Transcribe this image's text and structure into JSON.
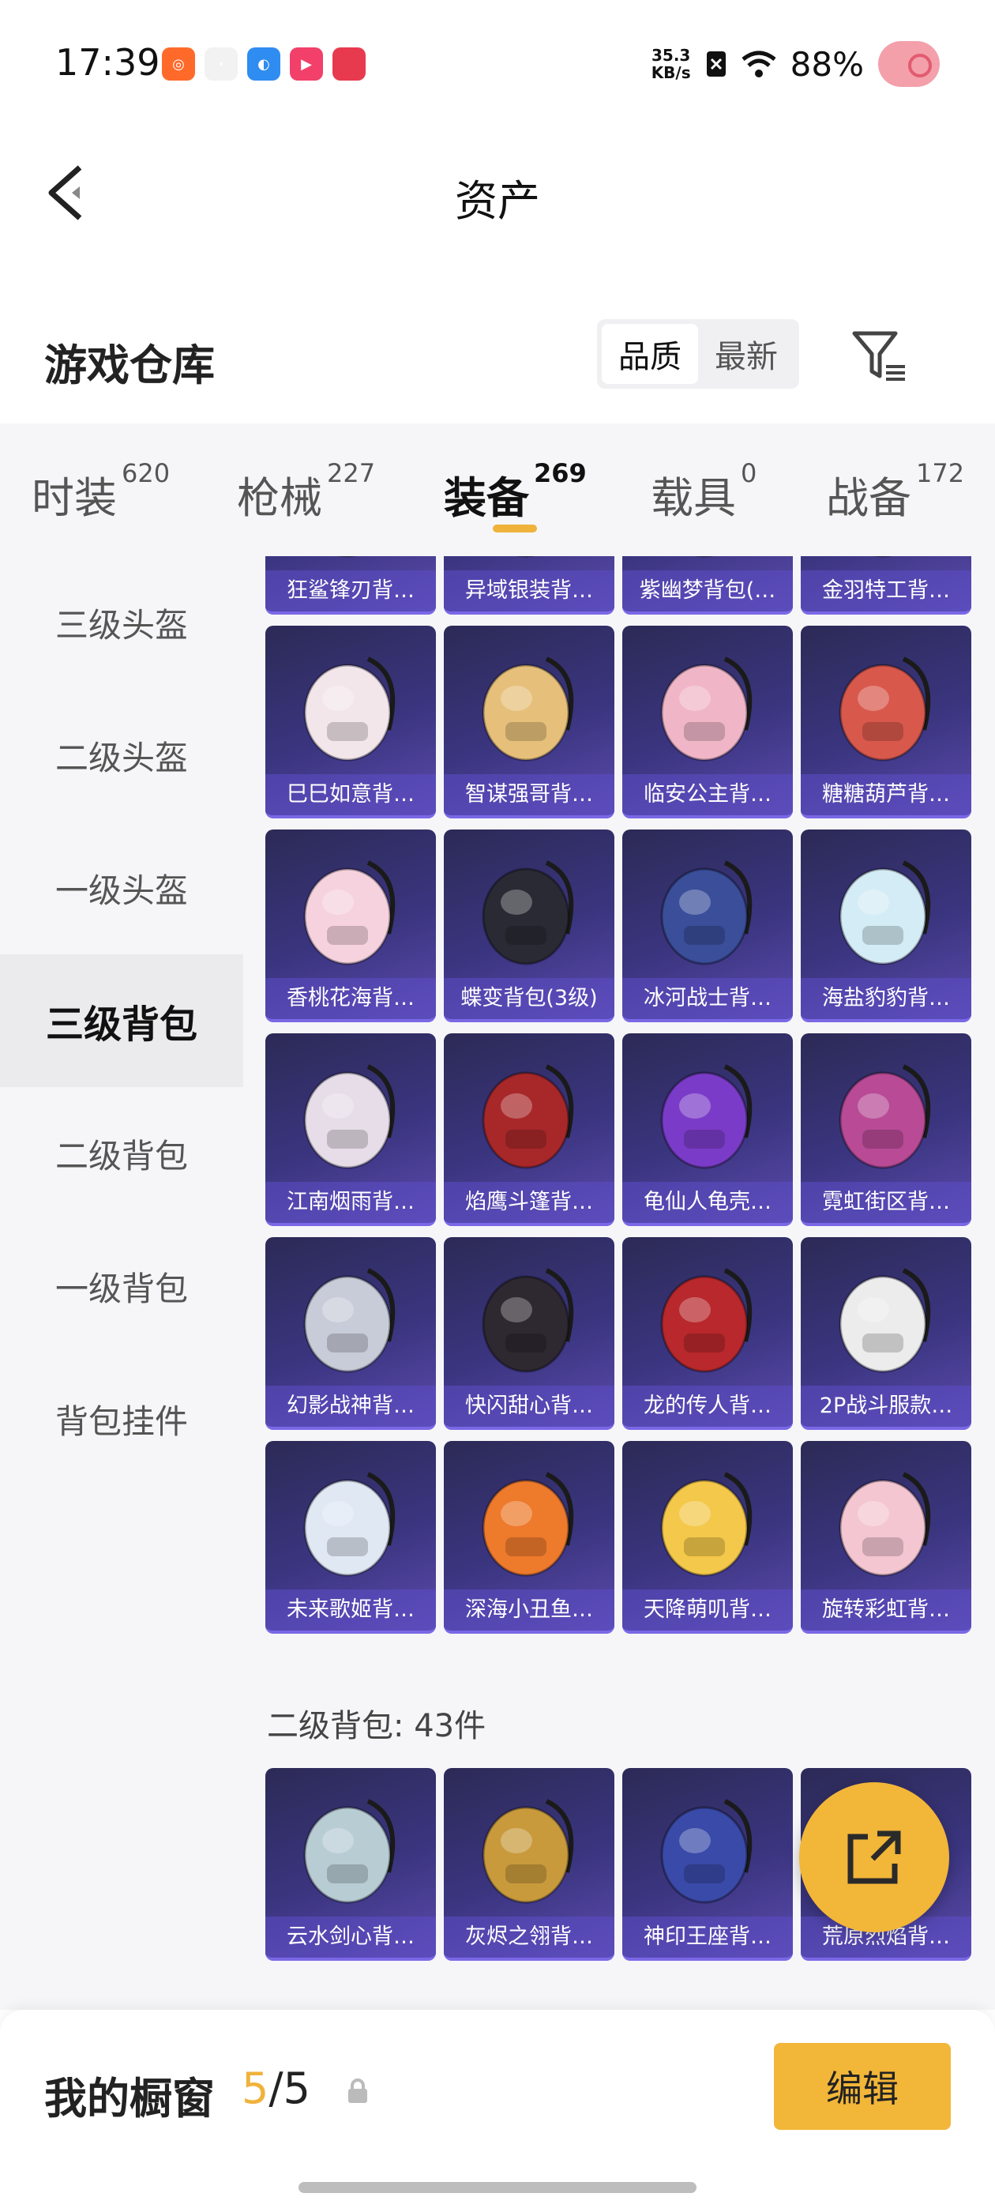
{
  "status": {
    "time": "17:39",
    "net_speed_value": "35.3",
    "net_speed_unit": "KB/s",
    "battery": "88%",
    "app_icons": [
      {
        "name": "kuaishou-app-icon",
        "color": "#ff6a2b",
        "glyph": "◎"
      },
      {
        "name": "small-app-icon",
        "color": "#f2f2f2",
        "glyph": "·"
      },
      {
        "name": "blue-app-icon",
        "color": "#2f8cf0",
        "glyph": "◐"
      },
      {
        "name": "video-app-icon",
        "color": "#f2406a",
        "glyph": "▶"
      },
      {
        "name": "red-app-icon",
        "color": "#e83a4f",
        "glyph": ""
      }
    ]
  },
  "header": {
    "title": "资产"
  },
  "warehouse": {
    "title": "游戏仓库",
    "sort_options": [
      "品质",
      "最新"
    ],
    "active_sort": "品质"
  },
  "tabs": [
    {
      "label": "时装",
      "count": "620"
    },
    {
      "label": "枪械",
      "count": "227"
    },
    {
      "label": "装备",
      "count": "269"
    },
    {
      "label": "载具",
      "count": "0"
    },
    {
      "label": "战备",
      "count": "172"
    }
  ],
  "sidebar": {
    "items": [
      "三级头盔",
      "二级头盔",
      "一级头盔",
      "三级背包",
      "二级背包",
      "一级背包",
      "背包挂件"
    ],
    "active": "三级背包"
  },
  "grid_level3": {
    "items": [
      {
        "label": "狂鲨锋刃背…",
        "color": "#8a6a3a"
      },
      {
        "label": "异域银装背…",
        "color": "#5c7a8a"
      },
      {
        "label": "紫幽梦背包(…",
        "color": "#b8a8e8"
      },
      {
        "label": "金羽特工背…",
        "color": "#4a4030"
      },
      {
        "label": "巳巳如意背…",
        "color": "#f3e6ea"
      },
      {
        "label": "智谋强哥背…",
        "color": "#e6c07a"
      },
      {
        "label": "临安公主背…",
        "color": "#f0b6c8"
      },
      {
        "label": "糖糖葫芦背…",
        "color": "#d8584c"
      },
      {
        "label": "香桃花海背…",
        "color": "#f6d2de"
      },
      {
        "label": "蝶变背包(3级)",
        "color": "#2a2a34"
      },
      {
        "label": "冰河战士背…",
        "color": "#3a4e9a"
      },
      {
        "label": "海盐豹豹背…",
        "color": "#d4ecf6"
      },
      {
        "label": "江南烟雨背…",
        "color": "#e6dde8"
      },
      {
        "label": "焰鹰斗篷背…",
        "color": "#a8282a"
      },
      {
        "label": "龟仙人龟壳…",
        "color": "#7a3cc8"
      },
      {
        "label": "霓虹街区背…",
        "color": "#b84a96"
      },
      {
        "label": "幻影战神背…",
        "color": "#c8ccd8"
      },
      {
        "label": "快闪甜心背…",
        "color": "#2e2830"
      },
      {
        "label": "龙的传人背…",
        "color": "#b8282c"
      },
      {
        "label": "2P战斗服款…",
        "color": "#ececec"
      },
      {
        "label": "未来歌姬背…",
        "color": "#e0e8f4"
      },
      {
        "label": "深海小丑鱼…",
        "color": "#ee7a2c"
      },
      {
        "label": "天降萌叽背…",
        "color": "#f4c84a"
      },
      {
        "label": "旋转彩虹背…",
        "color": "#f4c6d2"
      }
    ]
  },
  "section_level2": {
    "label": "二级背包: 43件",
    "items": [
      {
        "label": "云水剑心背…",
        "color": "#b8ccd4"
      },
      {
        "label": "灰烬之翎背…",
        "color": "#c89a3c"
      },
      {
        "label": "神印王座背…",
        "color": "#3a4aa8"
      },
      {
        "label": "荒原烈焰背…",
        "color": "#9a4030"
      }
    ]
  },
  "showcase": {
    "title": "我的橱窗",
    "count_current": "5",
    "count_separator": "/",
    "count_total": "5",
    "edit_label": "编辑"
  }
}
